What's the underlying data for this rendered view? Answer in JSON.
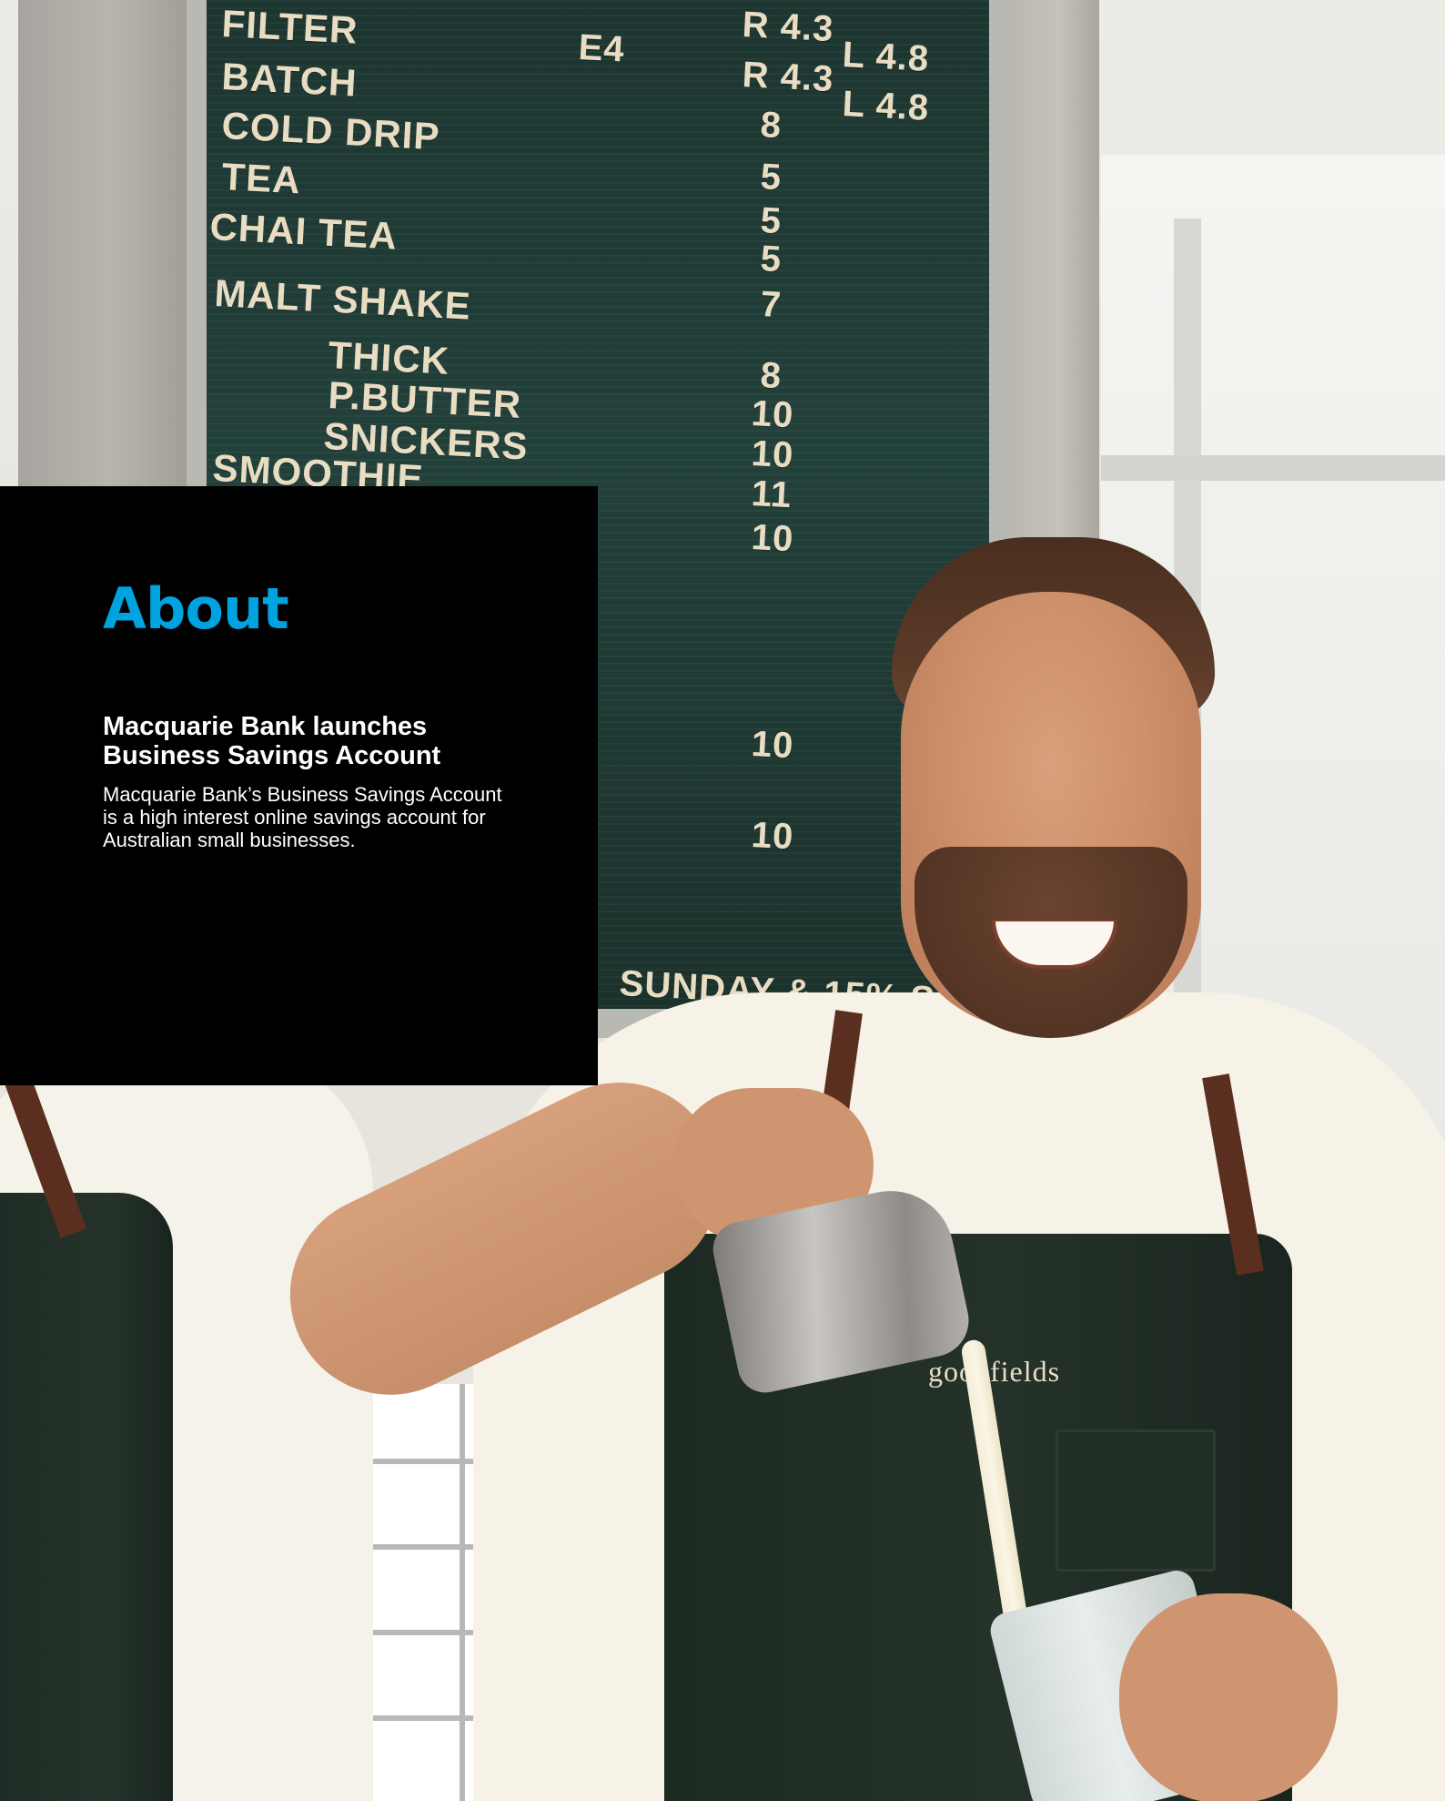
{
  "section": {
    "title": "About"
  },
  "story": {
    "headline": "Macquarie Bank launches Business Savings Account",
    "body": "Macquarie Bank’s Business Savings Account is a high interest online savings account for Australian small businesses."
  },
  "photo": {
    "menu_board_lines": [
      "FILTER",
      "E4",
      "R 4.3",
      "L 4.8",
      "BATCH",
      "R 4.3",
      "L 4.8",
      "COLD DRIP",
      "8",
      "TEA",
      "5",
      "CHAI TEA",
      "5",
      "5",
      "MALT SHAKE",
      "7",
      "THICK",
      "8",
      "P.BUTTER",
      "10",
      "SNICKERS",
      "10",
      "SMOOTHIE",
      "11",
      "10",
      "10",
      "10",
      "SUNDAY & 15% S"
    ],
    "apron_logo": "goodfields"
  },
  "colors": {
    "accent": "#00a2e0",
    "panel": "#000000",
    "text": "#ffffff"
  }
}
